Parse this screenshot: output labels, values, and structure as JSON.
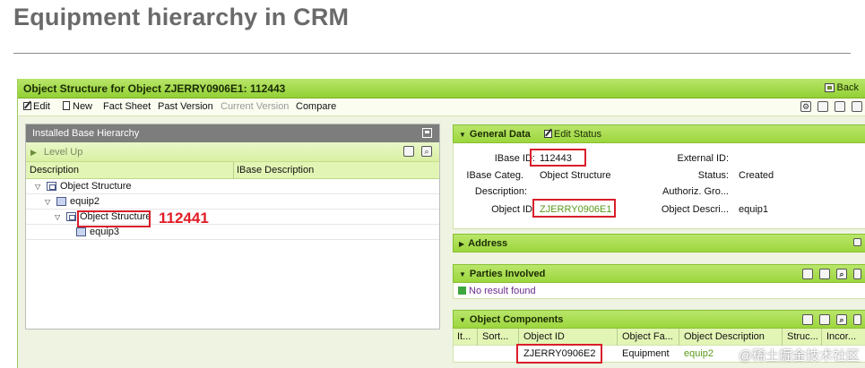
{
  "page": {
    "title": "Equipment hierarchy in CRM"
  },
  "window": {
    "title": "Object Structure for Object ZJERRY0906E1: 112443",
    "back_label": "Back"
  },
  "toolbar": {
    "edit": "Edit",
    "new": "New",
    "fact_sheet": "Fact Sheet",
    "past_version": "Past Version",
    "current_version": "Current Version",
    "compare": "Compare"
  },
  "hierarchy": {
    "header": "Installed Base Hierarchy",
    "level_up": "Level Up",
    "col_description": "Description",
    "col_ibase_description": "IBase Description",
    "rows": [
      {
        "label": "Object Structure"
      },
      {
        "label": "equip2"
      },
      {
        "label": "Object Structure"
      },
      {
        "label": "equip3"
      }
    ],
    "annotation": "112441"
  },
  "general": {
    "header": "General Data",
    "edit_status": "Edit Status",
    "ibase_id_label": "IBase ID:",
    "ibase_id_value": "112443",
    "ibase_categ_label": "IBase Categ.",
    "ibase_categ_value": "Object Structure",
    "description_label": "Description:",
    "object_id_label": "Object ID:",
    "object_id_value": "ZJERRY0906E1",
    "external_id_label": "External ID:",
    "status_label": "Status:",
    "status_value": "Created",
    "authoriz_label": "Authoriz. Gro...",
    "object_descr_label": "Object Descri...",
    "object_descr_value": "equip1"
  },
  "address": {
    "header": "Address"
  },
  "parties": {
    "header": "Parties Involved",
    "empty_text": "No result found"
  },
  "components": {
    "header": "Object Components",
    "columns": [
      "It...",
      "Sort...",
      "Object ID",
      "Object Fa...",
      "Object Description",
      "Struc...",
      "Incor..."
    ],
    "row": {
      "object_id": "ZJERRY0906E2",
      "family": "Equipment",
      "description": "equip2"
    }
  },
  "watermark": "@稀土掘金技术社区",
  "colors": {
    "accent_green": "#9dd63e",
    "annotation_red": "#d81e2a",
    "link_green": "#5a9a1a"
  }
}
